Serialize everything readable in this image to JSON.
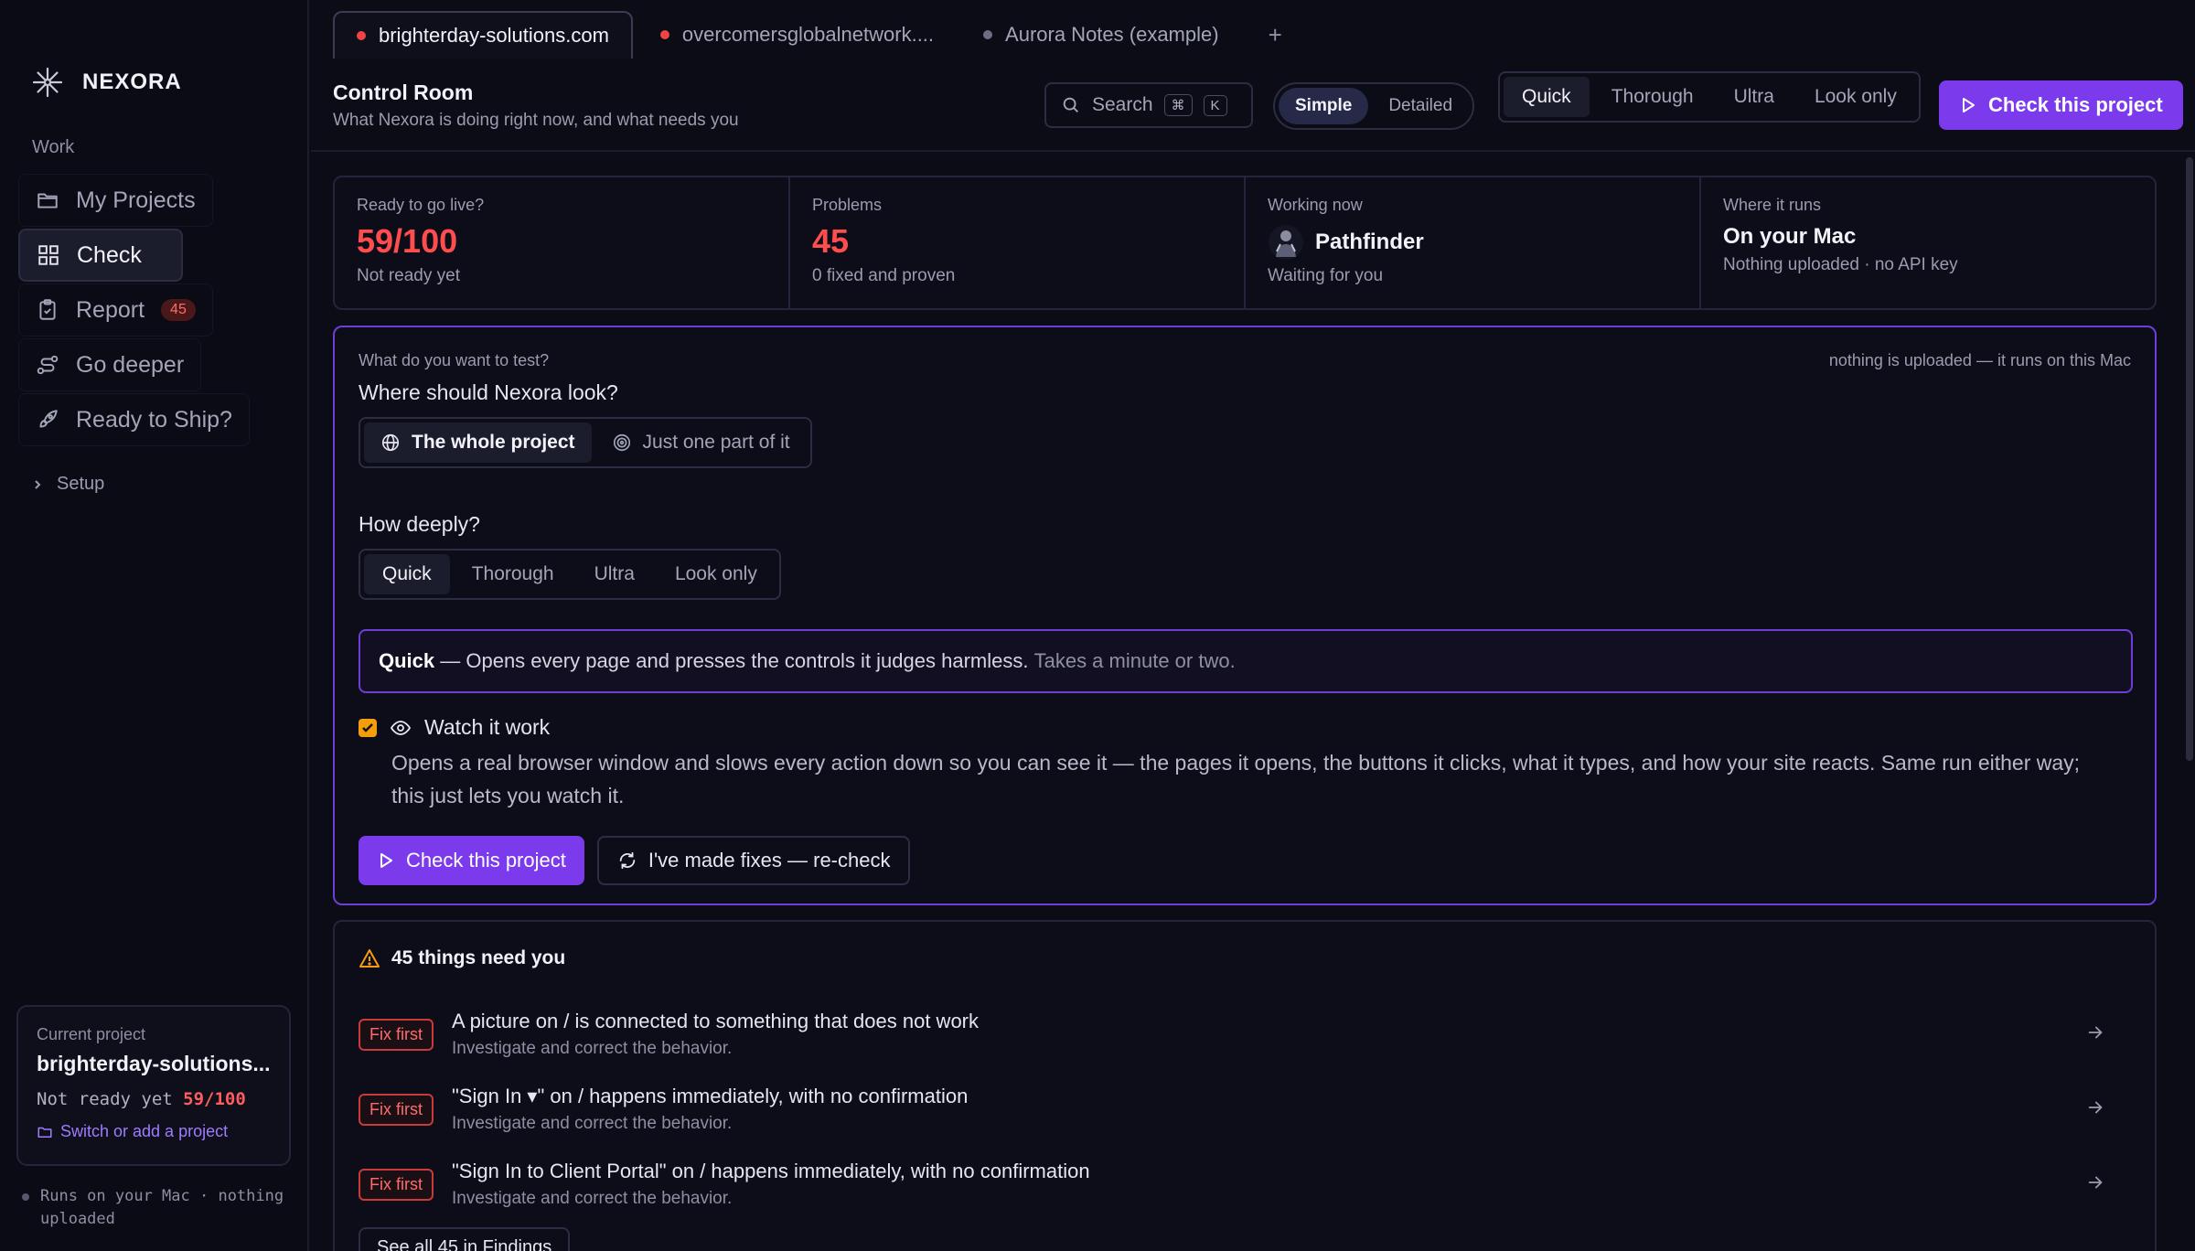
{
  "app": {
    "name": "NEXORA"
  },
  "sidebar": {
    "section": "Work",
    "items": [
      {
        "label": "My Projects",
        "icon": "folder-icon"
      },
      {
        "label": "Check",
        "icon": "grid-icon"
      },
      {
        "label": "Report",
        "icon": "clipboard-icon",
        "badge": "45"
      },
      {
        "label": "Go deeper",
        "icon": "route-icon"
      },
      {
        "label": "Ready to Ship?",
        "icon": "rocket-icon"
      }
    ],
    "setup": "Setup",
    "project": {
      "label": "Current project",
      "name": "brighterday-solutions....",
      "status_text": "Not ready yet",
      "score": "59/100",
      "switch_link": "Switch or add a project"
    },
    "footer": "Runs on your Mac · nothing uploaded"
  },
  "tabs": [
    {
      "label": "brighterday-solutions.com",
      "dot": "#ef4444"
    },
    {
      "label": "overcomersglobalnetwork....",
      "dot": "#ef4444"
    },
    {
      "label": "Aurora Notes (example)",
      "dot": "#6b6e85"
    }
  ],
  "tab_add": "+",
  "header": {
    "title": "Control Room",
    "subtitle": "What Nexora is doing right now, and what needs you",
    "search_label": "Search",
    "search_kbd_1": "⌘",
    "search_kbd_2": "K",
    "view_modes": [
      "Simple",
      "Detailed"
    ],
    "depth_options": [
      "Quick",
      "Thorough",
      "Ultra",
      "Look only"
    ],
    "cta": "Check this project"
  },
  "stats": {
    "ready": {
      "label": "Ready to go live?",
      "value": "59/100",
      "sub": "Not ready yet"
    },
    "problems": {
      "label": "Problems",
      "value": "45",
      "sub": "0 fixed and proven"
    },
    "working": {
      "label": "Working now",
      "agent": "Pathfinder",
      "sub": "Waiting for you"
    },
    "where": {
      "label": "Where it runs",
      "value": "On your Mac",
      "sub": "Nothing uploaded · no API key"
    }
  },
  "test_panel": {
    "kicker": "What do you want to test?",
    "note": "nothing is uploaded — it runs on this Mac",
    "where_question": "Where should Nexora look?",
    "scope_options": [
      "The whole project",
      "Just one part of it"
    ],
    "depth_question": "How deeply?",
    "depth_options": [
      "Quick",
      "Thorough",
      "Ultra",
      "Look only"
    ],
    "desc_name": "Quick",
    "desc_text": " — Opens every page and presses the controls it judges harmless. ",
    "desc_time": "Takes a minute or two.",
    "watch_label": "Watch it work",
    "watch_desc": "Opens a real browser window and slows every action down so you can see it — the pages it opens, the buttons it clicks, what it types, and how your site reacts. Same run either way; this just lets you watch it.",
    "primary": "Check this project",
    "secondary": "I've made fixes — re-check"
  },
  "findings": {
    "heading": "45 things need you",
    "items": [
      {
        "badge": "Fix first",
        "title": "A picture on / is connected to something that does not work",
        "sub": "Investigate and correct the behavior."
      },
      {
        "badge": "Fix first",
        "title": "\"Sign In ▾\" on / happens immediately, with no confirmation",
        "sub": "Investigate and correct the behavior."
      },
      {
        "badge": "Fix first",
        "title": "\"Sign In to Client Portal\" on / happens immediately, with no confirmation",
        "sub": "Investigate and correct the behavior."
      }
    ],
    "see_all": "See all 45 in Findings"
  },
  "colors": {
    "accent": "#7c3aed",
    "danger": "#ff4d4d",
    "background": "#0b0c16"
  }
}
